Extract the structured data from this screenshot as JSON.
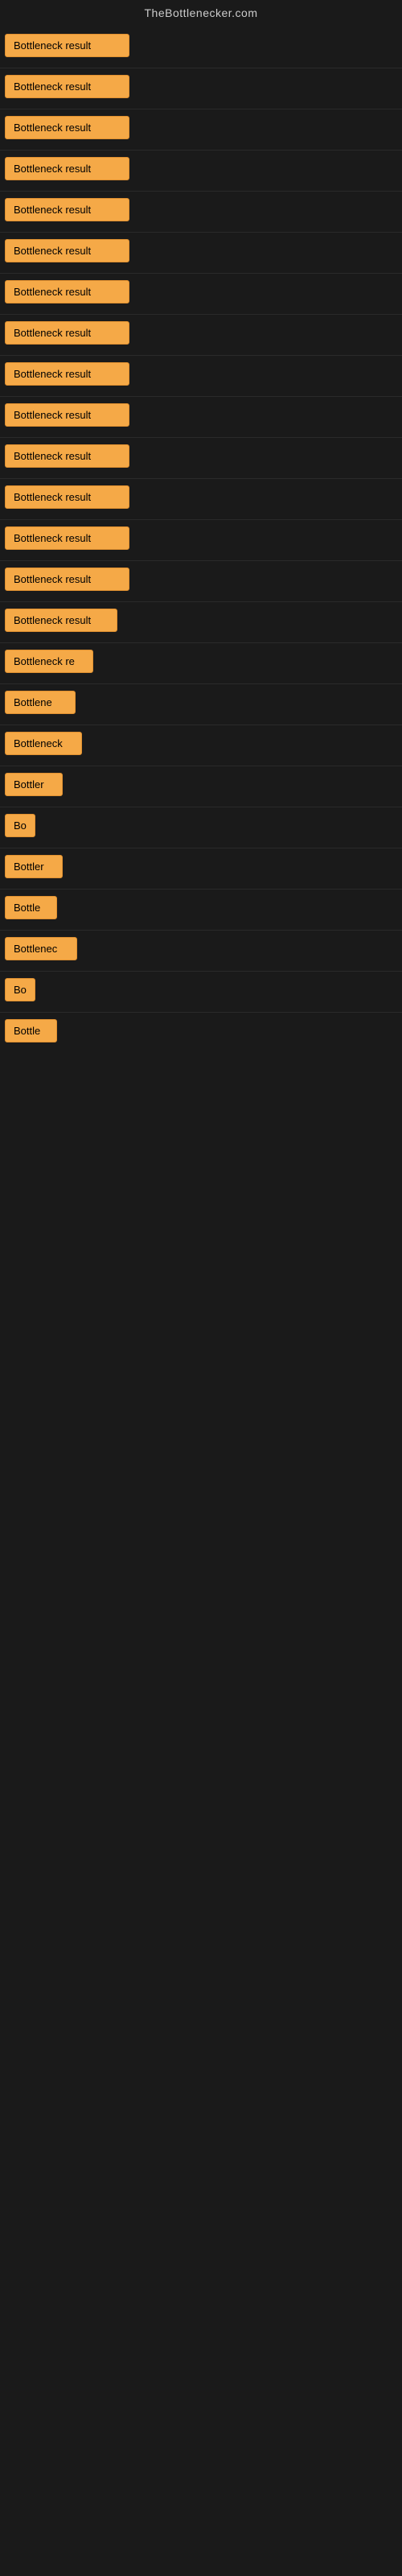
{
  "header": {
    "title": "TheBottlenecker.com"
  },
  "rows": [
    {
      "id": 1,
      "label": "Bottleneck result",
      "width": 155
    },
    {
      "id": 2,
      "label": "Bottleneck result",
      "width": 155
    },
    {
      "id": 3,
      "label": "Bottleneck result",
      "width": 155
    },
    {
      "id": 4,
      "label": "Bottleneck result",
      "width": 155
    },
    {
      "id": 5,
      "label": "Bottleneck result",
      "width": 155
    },
    {
      "id": 6,
      "label": "Bottleneck result",
      "width": 155
    },
    {
      "id": 7,
      "label": "Bottleneck result",
      "width": 155
    },
    {
      "id": 8,
      "label": "Bottleneck result",
      "width": 155
    },
    {
      "id": 9,
      "label": "Bottleneck result",
      "width": 155
    },
    {
      "id": 10,
      "label": "Bottleneck result",
      "width": 155
    },
    {
      "id": 11,
      "label": "Bottleneck result",
      "width": 155
    },
    {
      "id": 12,
      "label": "Bottleneck result",
      "width": 155
    },
    {
      "id": 13,
      "label": "Bottleneck result",
      "width": 155
    },
    {
      "id": 14,
      "label": "Bottleneck result",
      "width": 155
    },
    {
      "id": 15,
      "label": "Bottleneck result",
      "width": 140
    },
    {
      "id": 16,
      "label": "Bottleneck re",
      "width": 110
    },
    {
      "id": 17,
      "label": "Bottlene",
      "width": 88
    },
    {
      "id": 18,
      "label": "Bottleneck",
      "width": 96
    },
    {
      "id": 19,
      "label": "Bottler",
      "width": 72
    },
    {
      "id": 20,
      "label": "Bo",
      "width": 38
    },
    {
      "id": 21,
      "label": "Bottler",
      "width": 72
    },
    {
      "id": 22,
      "label": "Bottle",
      "width": 65
    },
    {
      "id": 23,
      "label": "Bottlenec",
      "width": 90
    },
    {
      "id": 24,
      "label": "Bo",
      "width": 38
    },
    {
      "id": 25,
      "label": "Bottle",
      "width": 65
    }
  ]
}
